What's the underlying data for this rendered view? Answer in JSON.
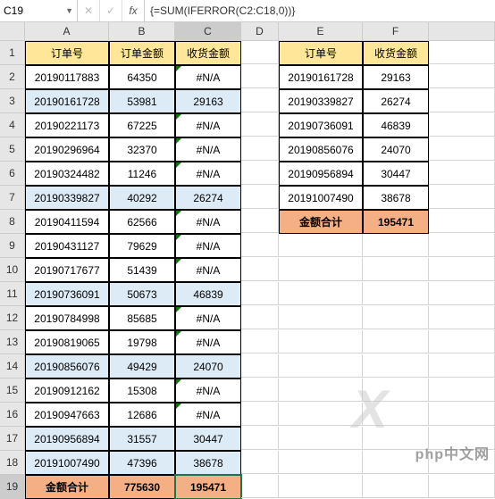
{
  "nameBox": "C19",
  "formula": "{=SUM(IFERROR(C2:C18,0))}",
  "columns": [
    "A",
    "B",
    "C",
    "D",
    "E",
    "F"
  ],
  "rows": [
    1,
    2,
    3,
    4,
    5,
    6,
    7,
    8,
    9,
    10,
    11,
    12,
    13,
    14,
    15,
    16,
    17,
    18,
    19
  ],
  "main": {
    "headers": [
      "订单号",
      "订单金额",
      "收货金额"
    ],
    "data": [
      {
        "id": "20190117883",
        "amt": "64350",
        "recv": "#N/A",
        "hi": false,
        "err": true
      },
      {
        "id": "20190161728",
        "amt": "53981",
        "recv": "29163",
        "hi": true,
        "err": false
      },
      {
        "id": "20190221173",
        "amt": "67225",
        "recv": "#N/A",
        "hi": false,
        "err": true
      },
      {
        "id": "20190296964",
        "amt": "32370",
        "recv": "#N/A",
        "hi": false,
        "err": true
      },
      {
        "id": "20190324482",
        "amt": "11246",
        "recv": "#N/A",
        "hi": false,
        "err": true
      },
      {
        "id": "20190339827",
        "amt": "40292",
        "recv": "26274",
        "hi": true,
        "err": false
      },
      {
        "id": "20190411594",
        "amt": "62566",
        "recv": "#N/A",
        "hi": false,
        "err": true
      },
      {
        "id": "20190431127",
        "amt": "79629",
        "recv": "#N/A",
        "hi": false,
        "err": true
      },
      {
        "id": "20190717677",
        "amt": "51439",
        "recv": "#N/A",
        "hi": false,
        "err": true
      },
      {
        "id": "20190736091",
        "amt": "50673",
        "recv": "46839",
        "hi": true,
        "err": false
      },
      {
        "id": "20190784998",
        "amt": "85685",
        "recv": "#N/A",
        "hi": false,
        "err": true
      },
      {
        "id": "20190819065",
        "amt": "19798",
        "recv": "#N/A",
        "hi": false,
        "err": true
      },
      {
        "id": "20190856076",
        "amt": "49429",
        "recv": "24070",
        "hi": true,
        "err": false
      },
      {
        "id": "20190912162",
        "amt": "15308",
        "recv": "#N/A",
        "hi": false,
        "err": true
      },
      {
        "id": "20190947663",
        "amt": "12686",
        "recv": "#N/A",
        "hi": false,
        "err": true
      },
      {
        "id": "20190956894",
        "amt": "31557",
        "recv": "30447",
        "hi": true,
        "err": false
      },
      {
        "id": "20191007490",
        "amt": "47396",
        "recv": "38678",
        "hi": true,
        "err": false
      }
    ],
    "total": {
      "label": "金额合计",
      "amt": "775630",
      "recv": "195471"
    }
  },
  "side": {
    "headers": [
      "订单号",
      "收货金额"
    ],
    "data": [
      {
        "id": "20190161728",
        "recv": "29163"
      },
      {
        "id": "20190339827",
        "recv": "26274"
      },
      {
        "id": "20190736091",
        "recv": "46839"
      },
      {
        "id": "20190856076",
        "recv": "24070"
      },
      {
        "id": "20190956894",
        "recv": "30447"
      },
      {
        "id": "20191007490",
        "recv": "38678"
      }
    ],
    "total": {
      "label": "金额合计",
      "recv": "195471"
    }
  },
  "watermark": "php中文网",
  "chart_data": {
    "type": "table",
    "title": "",
    "tables": [
      {
        "columns": [
          "订单号",
          "订单金额",
          "收货金额"
        ],
        "rows": [
          [
            "20190117883",
            64350,
            null
          ],
          [
            "20190161728",
            53981,
            29163
          ],
          [
            "20190221173",
            67225,
            null
          ],
          [
            "20190296964",
            32370,
            null
          ],
          [
            "20190324482",
            11246,
            null
          ],
          [
            "20190339827",
            40292,
            26274
          ],
          [
            "20190411594",
            62566,
            null
          ],
          [
            "20190431127",
            79629,
            null
          ],
          [
            "20190717677",
            51439,
            null
          ],
          [
            "20190736091",
            50673,
            46839
          ],
          [
            "20190784998",
            85685,
            null
          ],
          [
            "20190819065",
            19798,
            null
          ],
          [
            "20190856076",
            49429,
            24070
          ],
          [
            "20190912162",
            15308,
            null
          ],
          [
            "20190947663",
            12686,
            null
          ],
          [
            "20190956894",
            31557,
            30447
          ],
          [
            "20191007490",
            47396,
            38678
          ]
        ],
        "totals": {
          "订单金额": 775630,
          "收货金额": 195471
        }
      },
      {
        "columns": [
          "订单号",
          "收货金额"
        ],
        "rows": [
          [
            "20190161728",
            29163
          ],
          [
            "20190339827",
            26274
          ],
          [
            "20190736091",
            46839
          ],
          [
            "20190856076",
            24070
          ],
          [
            "20190956894",
            30447
          ],
          [
            "20191007490",
            38678
          ]
        ],
        "totals": {
          "收货金额": 195471
        }
      }
    ]
  }
}
